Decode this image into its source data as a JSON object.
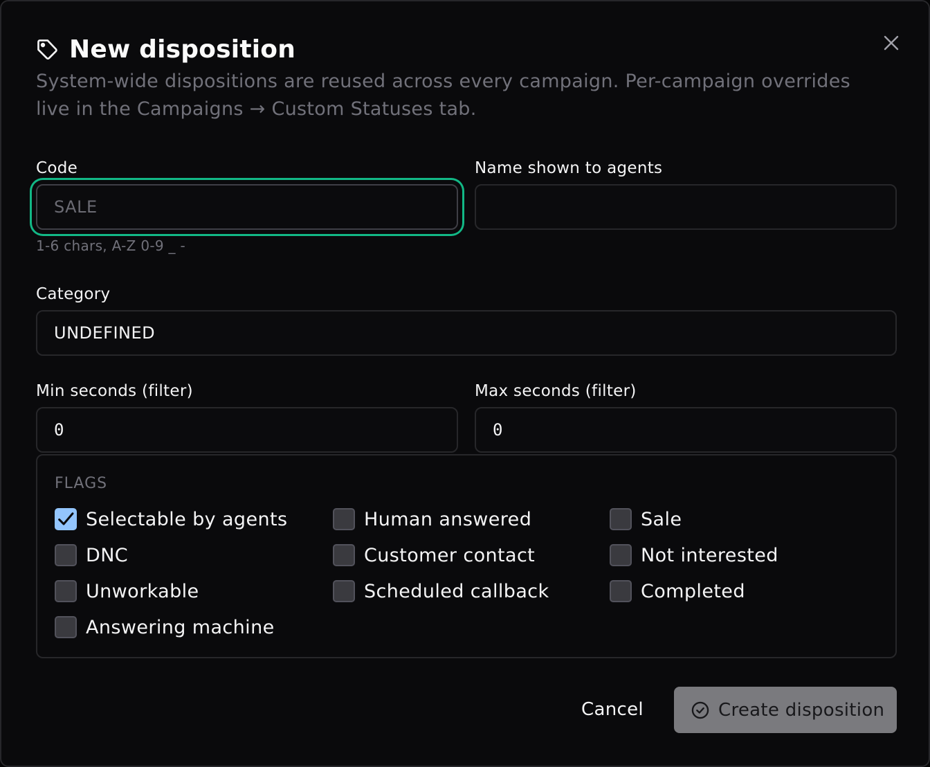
{
  "dialog": {
    "title": "New disposition",
    "description": "System-wide dispositions are reused across every campaign. Per-campaign overrides live in the Campaigns → Custom Statuses tab."
  },
  "form": {
    "code": {
      "label": "Code",
      "placeholder": "SALE",
      "value": "",
      "hint": "1-6 chars, A-Z 0-9 _ -"
    },
    "name": {
      "label": "Name shown to agents",
      "value": ""
    },
    "category": {
      "label": "Category",
      "value": "UNDEFINED"
    },
    "min_seconds": {
      "label": "Min seconds (filter)",
      "value": "0"
    },
    "max_seconds": {
      "label": "Max seconds (filter)",
      "value": "0"
    }
  },
  "flags": {
    "title": "FLAGS",
    "items": [
      {
        "label": "Selectable by agents",
        "checked": true
      },
      {
        "label": "Human answered",
        "checked": false
      },
      {
        "label": "Sale",
        "checked": false
      },
      {
        "label": "DNC",
        "checked": false
      },
      {
        "label": "Customer contact",
        "checked": false
      },
      {
        "label": "Not interested",
        "checked": false
      },
      {
        "label": "Unworkable",
        "checked": false
      },
      {
        "label": "Scheduled callback",
        "checked": false
      },
      {
        "label": "Completed",
        "checked": false
      },
      {
        "label": "Answering machine",
        "checked": false
      }
    ]
  },
  "actions": {
    "cancel_label": "Cancel",
    "create_label": "Create disposition"
  },
  "colors": {
    "focus_ring": "#12b886",
    "checkbox_checked": "#93c5fd",
    "primary_button_disabled": "#7a7a7e"
  },
  "icons": {
    "title": "tag-icon",
    "close": "close-icon",
    "create": "check-circle-icon",
    "checkmark": "checkmark-icon"
  }
}
